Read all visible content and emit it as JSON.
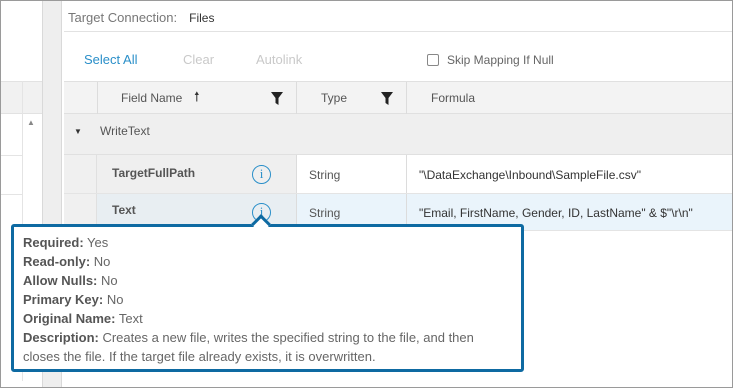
{
  "target_connection": {
    "label": "Target Connection:",
    "value": "Files"
  },
  "toolbar": {
    "select_all": "Select All",
    "clear": "Clear",
    "autolink": "Autolink",
    "skip_mapping_label": "Skip Mapping If Null",
    "skip_mapping_checked": false
  },
  "grid": {
    "headers": {
      "field_name": "Field Name",
      "type": "Type",
      "formula": "Formula"
    },
    "group_label": "WriteText",
    "rows": [
      {
        "field": "TargetFullPath",
        "type": "String",
        "formula": "\"\\DataExchange\\Inbound\\SampleFile.csv\""
      },
      {
        "field": "Text",
        "type": "String",
        "formula": "\"Email, FirstName, Gender, ID, LastName\" & $\"\\r\\n\""
      }
    ]
  },
  "tooltip": {
    "required_label": "Required:",
    "required_value": " Yes",
    "readonly_label": "Read-only:",
    "readonly_value": " No",
    "allow_nulls_label": "Allow Nulls:",
    "allow_nulls_value": " No",
    "primary_key_label": "Primary Key:",
    "primary_key_value": " No",
    "original_name_label": "Original Name:",
    "original_name_value": " Text",
    "description_label": "Description:",
    "description_value": " Creates a new file, writes the specified string to the file, and then closes the file. If the target file already exists, it is overwritten."
  },
  "colors": {
    "accent": "#2a8fc9",
    "tooltip_border": "#0e6aa2",
    "selected_row": "#eaf4fb"
  },
  "icons": {
    "sort": "arrow-up-icon",
    "filter": "filter-icon",
    "info": "info-icon",
    "collapse": "caret-down-icon"
  }
}
